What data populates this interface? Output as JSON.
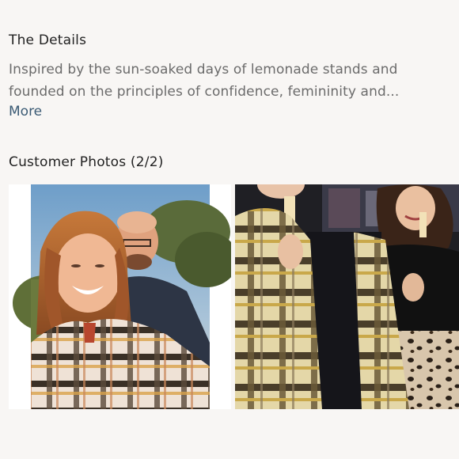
{
  "details": {
    "heading": "The Details",
    "text": "Inspired by the sun-soaked days of lemonade stands and founded on the principles of confidence, femininity and...",
    "more_label": "More"
  },
  "customer_photos": {
    "heading": "Customer Photos (2/2)",
    "photos": [
      {
        "alt": "Customer photo 1"
      },
      {
        "alt": "Customer photo 2"
      }
    ]
  }
}
